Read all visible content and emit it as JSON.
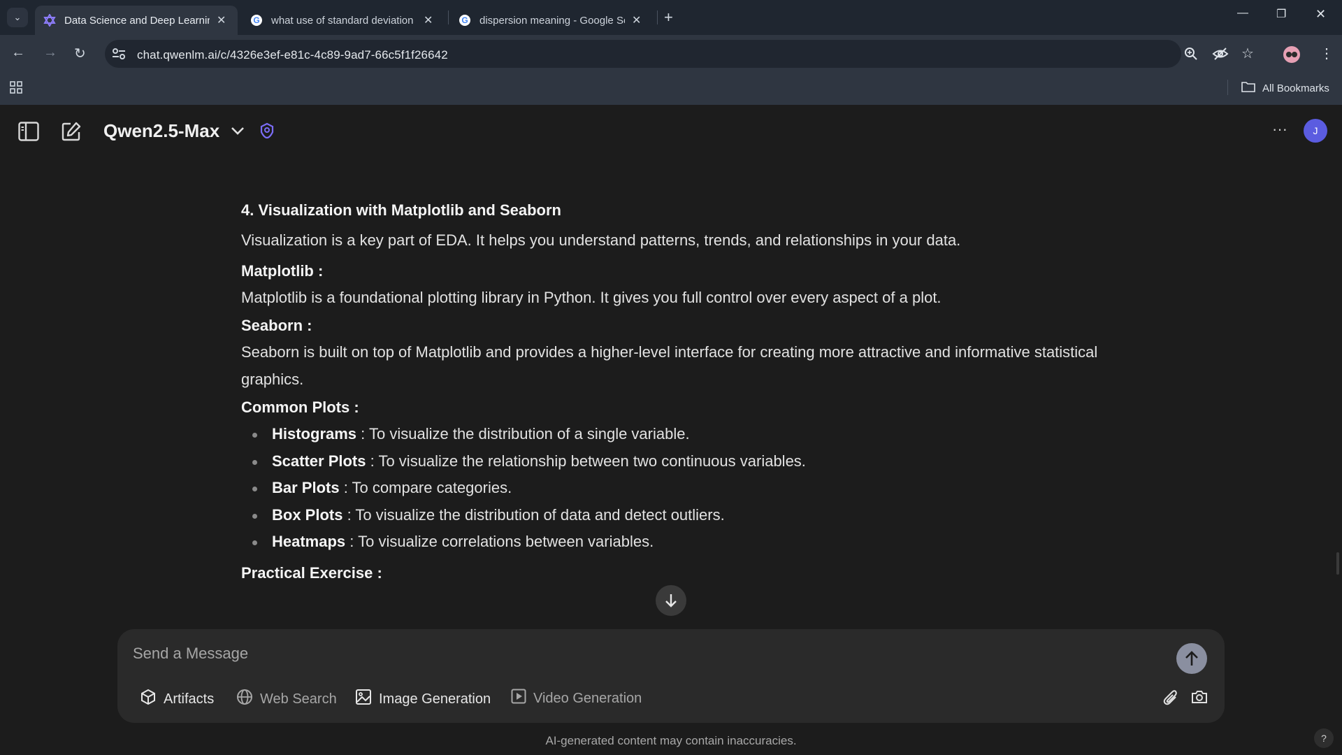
{
  "browser": {
    "tabs": [
      {
        "title": "Data Science and Deep Learnin",
        "icon": "qwen-favicon",
        "active": true
      },
      {
        "title": "what use of standard deviation",
        "icon": "google-favicon",
        "active": false
      },
      {
        "title": "dispersion meaning - Google Se",
        "icon": "google-favicon",
        "active": false
      }
    ],
    "url": "chat.qwenlm.ai/c/4326e3ef-e81c-4c89-9ad7-66c5f1f26642",
    "bookmarks_label": "All Bookmarks"
  },
  "app": {
    "model_name": "Qwen2.5-Max",
    "user_initial": "J"
  },
  "message": {
    "heading": "4. Visualization with Matplotlib and Seaborn",
    "intro": "Visualization is a key part of EDA. It helps you understand patterns, trends, and relationships in your data.",
    "matplotlib_title": "Matplotlib",
    "matplotlib_text": "Matplotlib is a foundational plotting library in Python. It gives you full control over every aspect of a plot.",
    "seaborn_title": "Seaborn",
    "seaborn_text": "Seaborn is built on top of Matplotlib and provides a higher-level interface for creating more attractive and informative statistical graphics.",
    "common_title": "Common Plots",
    "plots": [
      {
        "name": "Histograms",
        "desc": "To visualize the distribution of a single variable."
      },
      {
        "name": "Scatter Plots",
        "desc": "To visualize the relationship between two continuous variables."
      },
      {
        "name": "Bar Plots",
        "desc": "To compare categories."
      },
      {
        "name": "Box Plots",
        "desc": "To visualize the distribution of data and detect outliers."
      },
      {
        "name": "Heatmaps",
        "desc": "To visualize correlations between variables."
      }
    ],
    "exercise_title": "Practical Exercise",
    "colon": " :"
  },
  "composer": {
    "placeholder": "Send a Message",
    "tools": {
      "artifacts": "Artifacts",
      "web_search": "Web Search",
      "image_generation": "Image Generation",
      "video_generation": "Video Generation"
    }
  },
  "footer": {
    "disclaimer": "AI-generated content may contain inaccuracies.",
    "help": "?"
  }
}
